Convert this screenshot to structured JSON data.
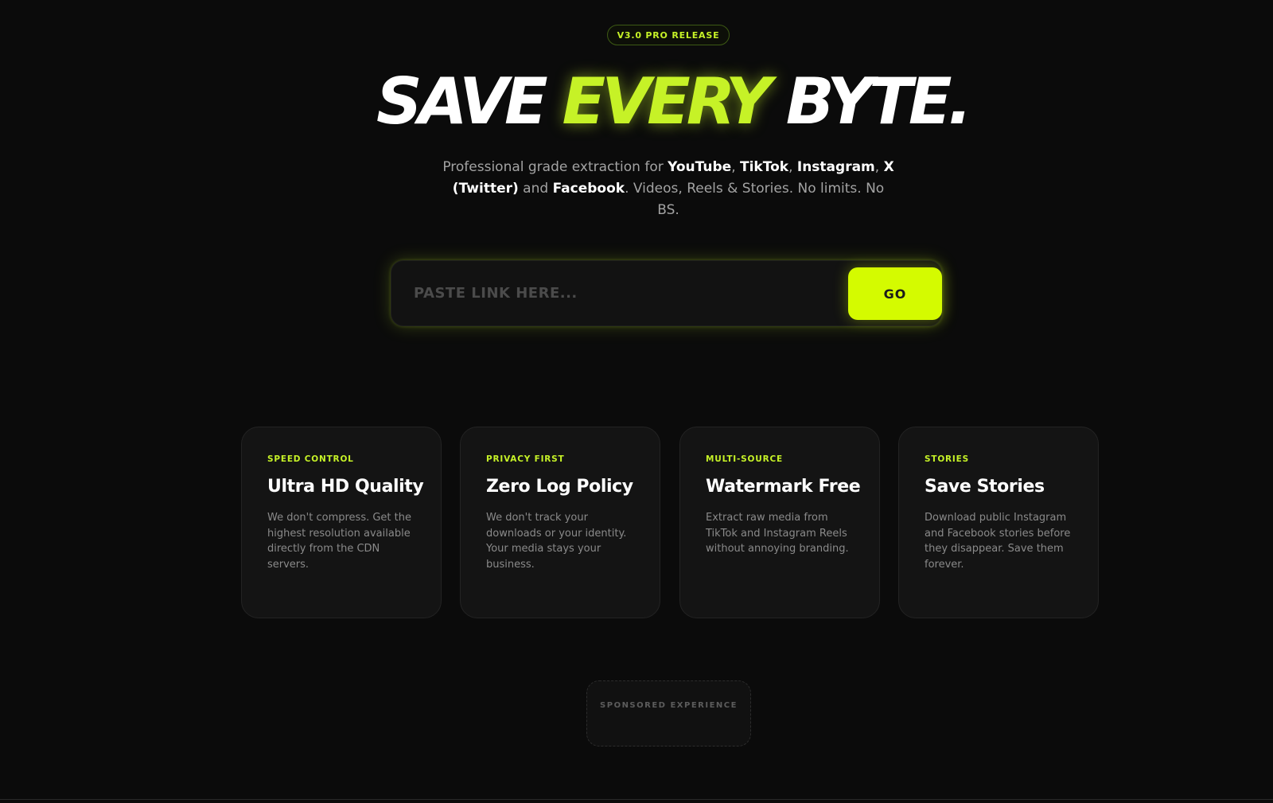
{
  "badge": {
    "label": "V3.0 PRO RELEASE"
  },
  "hero": {
    "title_part1": "SAVE ",
    "title_accent": "EVERY",
    "title_part2": " BYTE."
  },
  "subtitle": {
    "prefix": "Professional grade extraction for ",
    "platform_youtube": "YouTube",
    "sep1": ", ",
    "platform_tiktok": "TikTok",
    "sep2": ", ",
    "platform_instagram": "Instagram",
    "sep3": ", ",
    "platform_x": "X (Twitter)",
    "sep4": " and ",
    "platform_facebook": "Facebook",
    "suffix": ". Videos, Reels & Stories. No limits. No BS."
  },
  "search": {
    "placeholder": "PASTE LINK HERE...",
    "value": "",
    "button_label": "GO"
  },
  "cards": [
    {
      "eyebrow": "SPEED CONTROL",
      "title": "Ultra HD Quality",
      "description": "We don't compress. Get the highest resolution available directly from the CDN servers."
    },
    {
      "eyebrow": "PRIVACY FIRST",
      "title": "Zero Log Policy",
      "description": "We don't track your downloads or your identity. Your media stays your business."
    },
    {
      "eyebrow": "MULTI-SOURCE",
      "title": "Watermark Free",
      "description": "Extract raw media from TikTok and Instagram Reels without annoying branding."
    },
    {
      "eyebrow": "STORIES",
      "title": "Save Stories",
      "description": "Download public Instagram and Facebook stories before they disappear. Save them forever."
    }
  ],
  "sponsor": {
    "label": "SPONSORED EXPERIENCE"
  },
  "colors": {
    "background": "#0b0b0b",
    "accent": "#c6f227",
    "button": "#d4fb00",
    "card": "#141414",
    "muted_text": "#8a8a8a"
  }
}
